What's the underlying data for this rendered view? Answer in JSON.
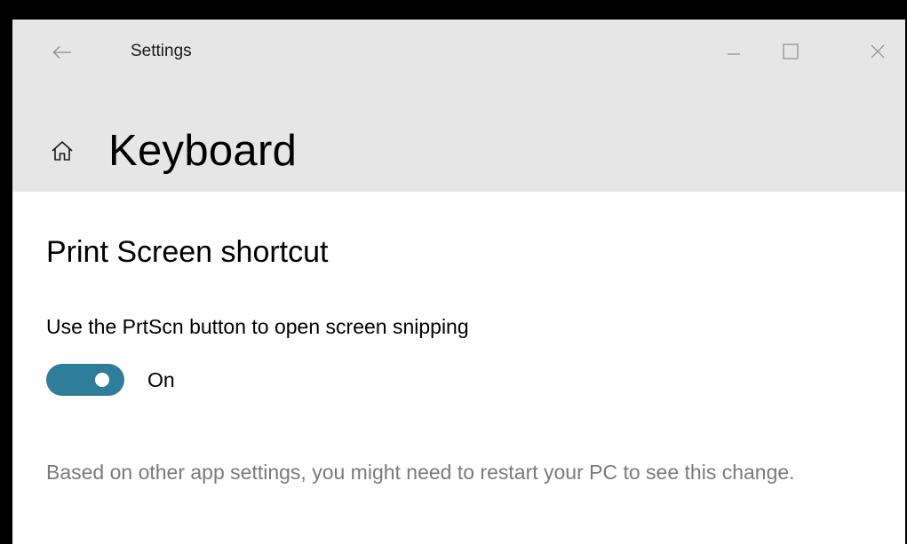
{
  "titlebar": {
    "back_icon": "back-arrow-icon",
    "title": "Settings",
    "minimize_icon": "minimize-icon",
    "maximize_icon": "maximize-icon",
    "close_icon": "close-icon"
  },
  "header": {
    "home_icon": "home-icon",
    "title": "Keyboard"
  },
  "section": {
    "title": "Print Screen shortcut",
    "setting_label": "Use the PrtScn button to open screen snipping",
    "toggle": {
      "state_label": "On",
      "is_on": true
    },
    "note": "Based on other app settings, you might need to restart your PC to see this change."
  },
  "colors": {
    "titlebar_bg": "#e6e6e6",
    "content_bg": "#ffffff",
    "toggle_on": "#2e7d9a",
    "note_text": "#7a7a7a"
  }
}
